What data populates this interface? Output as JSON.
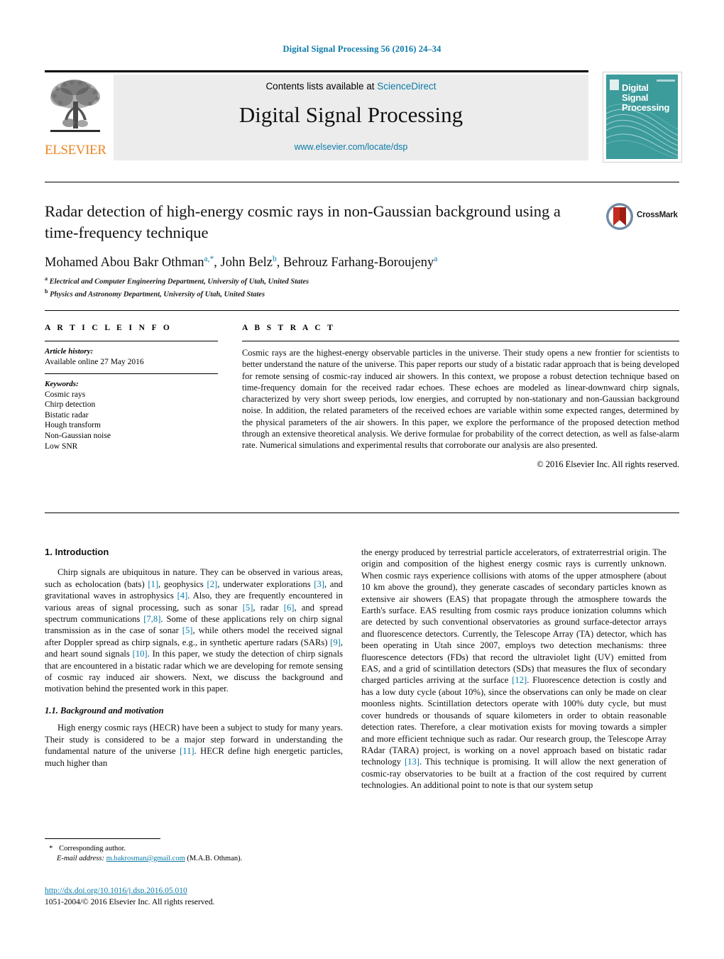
{
  "running_head": "Digital Signal Processing 56 (2016) 24–34",
  "masthead": {
    "contents_prefix": "Contents lists available at ",
    "contents_link": "ScienceDirect",
    "journal_name": "Digital Signal Processing",
    "journal_url": "www.elsevier.com/locate/dsp",
    "publisher_logo_text": "ELSEVIER",
    "cover_title_line1": "Digital",
    "cover_title_line2": "Signal",
    "cover_title_line3": "Processing"
  },
  "article": {
    "title": "Radar detection of high-energy cosmic rays in non-Gaussian background using a time-frequency technique",
    "crossmark_label": "CrossMark",
    "authors": [
      {
        "name": "Mohamed Abou Bakr Othman",
        "marks": "a,*"
      },
      {
        "name": "John Belz",
        "marks": "b"
      },
      {
        "name": "Behrouz Farhang-Boroujeny",
        "marks": "a"
      }
    ],
    "affiliations": [
      {
        "mark": "a",
        "text": "Electrical and Computer Engineering Department, University of Utah, United States"
      },
      {
        "mark": "b",
        "text": "Physics and Astronomy Department, University of Utah, United States"
      }
    ]
  },
  "article_info": {
    "heading": "A R T I C L E   I N F O",
    "history_label": "Article history:",
    "history_value": "Available online 27 May 2016",
    "keywords_label": "Keywords:",
    "keywords": [
      "Cosmic rays",
      "Chirp detection",
      "Bistatic radar",
      "Hough transform",
      "Non-Gaussian noise",
      "Low SNR"
    ]
  },
  "abstract": {
    "heading": "A B S T R A C T",
    "text": "Cosmic rays are the highest-energy observable particles in the universe. Their study opens a new frontier for scientists to better understand the nature of the universe. This paper reports our study of a bistatic radar approach that is being developed for remote sensing of cosmic-ray induced air showers. In this context, we propose a robust detection technique based on time-frequency domain for the received radar echoes. These echoes are modeled as linear-downward chirp signals, characterized by very short sweep periods, low energies, and corrupted by non-stationary and non-Gaussian background noise. In addition, the related parameters of the received echoes are variable within some expected ranges, determined by the physical parameters of the air showers. In this paper, we explore the performance of the proposed detection method through an extensive theoretical analysis. We derive formulae for probability of the correct detection, as well as false-alarm rate. Numerical simulations and experimental results that corroborate our analysis are also presented.",
    "copyright": "© 2016 Elsevier Inc. All rights reserved."
  },
  "body": {
    "section_number_title": "1.  Introduction",
    "left_para_1_a": "Chirp signals are ubiquitous in nature. They can be observed in various areas, such as echolocation (bats) ",
    "left_para_1_c1": "[1]",
    "left_para_1_b": ", geophysics ",
    "left_para_1_c2": "[2]",
    "left_para_1_c": ", underwater explorations ",
    "left_para_1_c3": "[3]",
    "left_para_1_d": ", and gravitational waves in astrophysics ",
    "left_para_1_c4": "[4]",
    "left_para_1_e": ". Also, they are frequently encountered in various areas of signal processing, such as sonar ",
    "left_para_1_c5": "[5]",
    "left_para_1_f": ", radar ",
    "left_para_1_c6": "[6]",
    "left_para_1_g": ", and spread spectrum communications ",
    "left_para_1_c7": "[7,8]",
    "left_para_1_h": ". Some of these applications rely on chirp signal transmission as in the case of sonar ",
    "left_para_1_c8": "[5]",
    "left_para_1_i": ", while others model the received signal after Doppler spread as chirp signals, e.g., in synthetic aperture radars (SARs) ",
    "left_para_1_c9": "[9]",
    "left_para_1_j": ", and heart sound signals ",
    "left_para_1_c10": "[10]",
    "left_para_1_k": ". In this paper, we study the detection of chirp signals that are encountered in a bistatic radar which we are developing for remote sensing of cosmic ray induced air showers. Next, we discuss the background and motivation behind the presented work in this paper.",
    "subsection_title": "1.1.  Background and motivation",
    "left_para_2_a": "High energy cosmic rays (HECR) have been a subject to study for many years. Their study is considered to be a major step forward in understanding the fundamental nature of the universe ",
    "left_para_2_c1": "[11]",
    "left_para_2_b": ". HECR define high energetic particles, much higher than",
    "right_para_a": "the energy produced by terrestrial particle accelerators, of extraterrestrial origin. The origin and composition of the highest energy cosmic rays is currently unknown. When cosmic rays experience collisions with atoms of the upper atmosphere (about 10 km above the ground), they generate cascades of secondary particles known as extensive air showers (EAS) that propagate through the atmosphere towards the Earth's surface. EAS resulting from cosmic rays produce ionization columns which are detected by such conventional observatories as ground surface-detector arrays and fluorescence detectors. Currently, the Telescope Array (TA) detector, which has been operating in Utah since 2007, employs two detection mechanisms: three fluorescence detectors (FDs) that record the ultraviolet light (UV) emitted from EAS, and a grid of scintillation detectors (SDs) that measures the flux of secondary charged particles arriving at the surface ",
    "right_c1": "[12]",
    "right_para_b": ". Fluorescence detection is costly and has a low duty cycle (about 10%), since the observations can only be made on clear moonless nights. Scintillation detectors operate with 100% duty cycle, but must cover hundreds or thousands of square kilometers in order to obtain reasonable detection rates. Therefore, a clear motivation exists for moving towards a simpler and more efficient technique such as radar. Our research group, the Telescope Array RAdar (TARA) project, is working on a novel approach based on bistatic radar technology ",
    "right_c2": "[13]",
    "right_para_c": ". This technique is promising. It will allow the next generation of cosmic-ray observatories to be built at a fraction of the cost required by current technologies. An additional point to note is that our system setup"
  },
  "footnote": {
    "star": "*",
    "corresponding": "Corresponding author.",
    "email_label": "E-mail address:",
    "email": "m.bakrosman@gmail.com",
    "email_owner": "(M.A.B. Othman)."
  },
  "footer": {
    "doi": "http://dx.doi.org/10.1016/j.dsp.2016.05.010",
    "issn_line": "1051-2004/© 2016 Elsevier Inc. All rights reserved."
  },
  "colors": {
    "link": "#0b7aa8",
    "elsevier_orange": "#ec8622",
    "cover_teal": "#3c9b9b"
  }
}
